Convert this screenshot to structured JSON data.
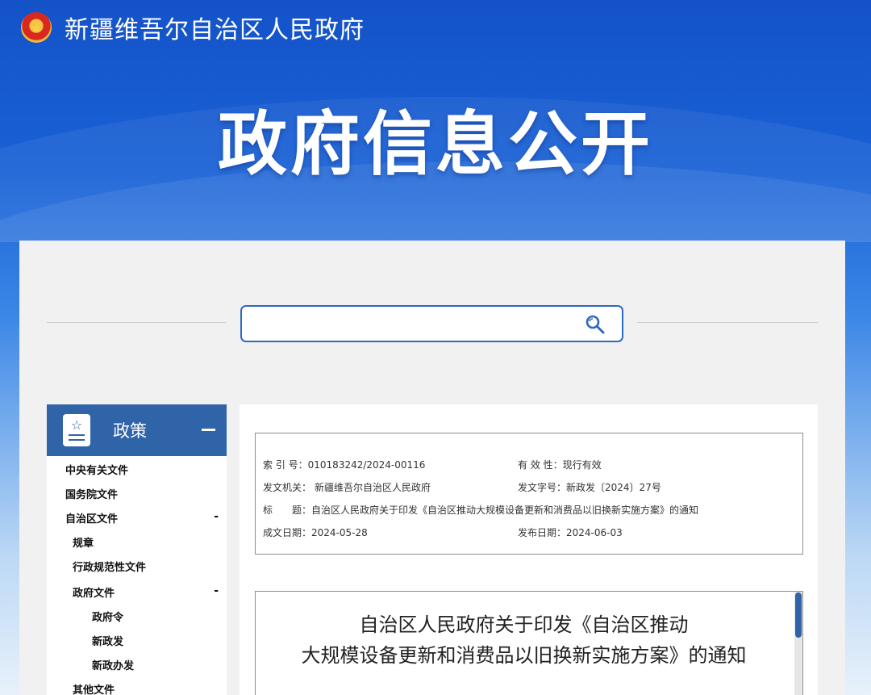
{
  "header": {
    "emblem_alt": "国徽",
    "site_name": "新疆维吾尔自治区人民政府"
  },
  "banner": {
    "title": "政府信息公开"
  },
  "search": {
    "value": "",
    "placeholder": ""
  },
  "sidebar": {
    "title": "政策",
    "items": [
      {
        "label": "中央有关文件",
        "toggle": ""
      },
      {
        "label": "国务院文件",
        "toggle": ""
      },
      {
        "label": "自治区文件",
        "toggle": "-"
      },
      {
        "label": "规章",
        "toggle": ""
      },
      {
        "label": "行政规范性文件",
        "toggle": ""
      },
      {
        "label": "政府文件",
        "toggle": "-"
      },
      {
        "label": "政府令",
        "toggle": ""
      },
      {
        "label": "新政发",
        "toggle": ""
      },
      {
        "label": "新政办发",
        "toggle": ""
      },
      {
        "label": "其他文件",
        "toggle": ""
      }
    ]
  },
  "meta": {
    "index_label": "索 引 号：",
    "index_value": "010183242/2024-00116",
    "validity_label": "有 效 性：",
    "validity_value": "现行有效",
    "issuer_label": "发文机关：",
    "issuer_value": "新疆维吾尔自治区人民政府",
    "doc_no_label": "发文字号：",
    "doc_no_value": "新政发〔2024〕27号",
    "title_label": "标　　题：",
    "title_value": "自治区人民政府关于印发《自治区推动大规模设备更新和消费品以旧换新实施方案》的通知",
    "written_label": "成文日期：",
    "written_value": "2024-05-28",
    "published_label": "发布日期：",
    "published_value": "2024-06-03"
  },
  "article": {
    "title_line1": "自治区人民政府关于印发《自治区推动",
    "title_line2": "大规模设备更新和消费品以旧换新实施方案》的通知"
  }
}
